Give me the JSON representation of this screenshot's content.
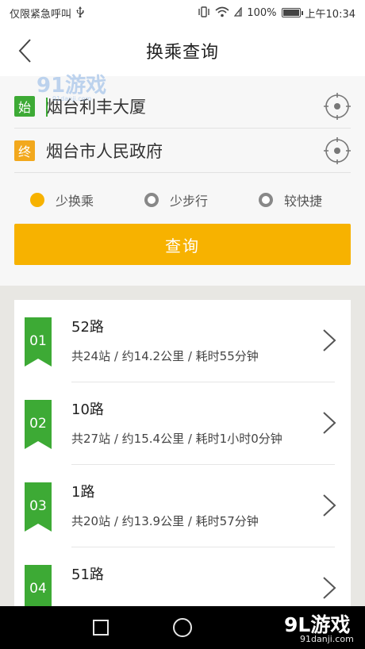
{
  "status_bar": {
    "carrier_text": "仅限紧急呼叫",
    "usb_icon": "usb-icon",
    "vibrate_icon": "vibrate-icon",
    "wifi_icon": "wifi-icon",
    "battery_percent": "100%",
    "charging_icon": "charging-icon",
    "time": "上午10:34"
  },
  "nav": {
    "title": "换乘查询",
    "back_icon": "chevron-left-icon"
  },
  "watermark_top": "91游戏",
  "form": {
    "start": {
      "tag": "始",
      "value": "烟台利丰大厦",
      "locate_icon": "crosshair-icon"
    },
    "end": {
      "tag": "终",
      "value": "烟台市人民政府",
      "locate_icon": "crosshair-icon"
    },
    "preferences": [
      {
        "label": "少换乘",
        "selected": true
      },
      {
        "label": "少步行",
        "selected": false
      },
      {
        "label": "较快捷",
        "selected": false
      }
    ],
    "query_label": "查询"
  },
  "routes": [
    {
      "index": "01",
      "name": "52路",
      "detail": "共24站 / 约14.2公里 / 耗时55分钟"
    },
    {
      "index": "02",
      "name": "10路",
      "detail": "共27站 / 约15.4公里 / 耗时1小时0分钟"
    },
    {
      "index": "03",
      "name": "1路",
      "detail": "共20站 / 约13.9公里 / 耗时57分钟"
    },
    {
      "index": "04",
      "name": "51路",
      "detail": ""
    }
  ],
  "colors": {
    "green": "#3daa35",
    "orange": "#f2a81d",
    "yellow": "#f7b200"
  },
  "system_nav": {
    "recents_icon": "square-icon",
    "home_icon": "circle-icon"
  },
  "brand_watermark": {
    "main": "9L游戏",
    "sub": "91danji.com"
  }
}
